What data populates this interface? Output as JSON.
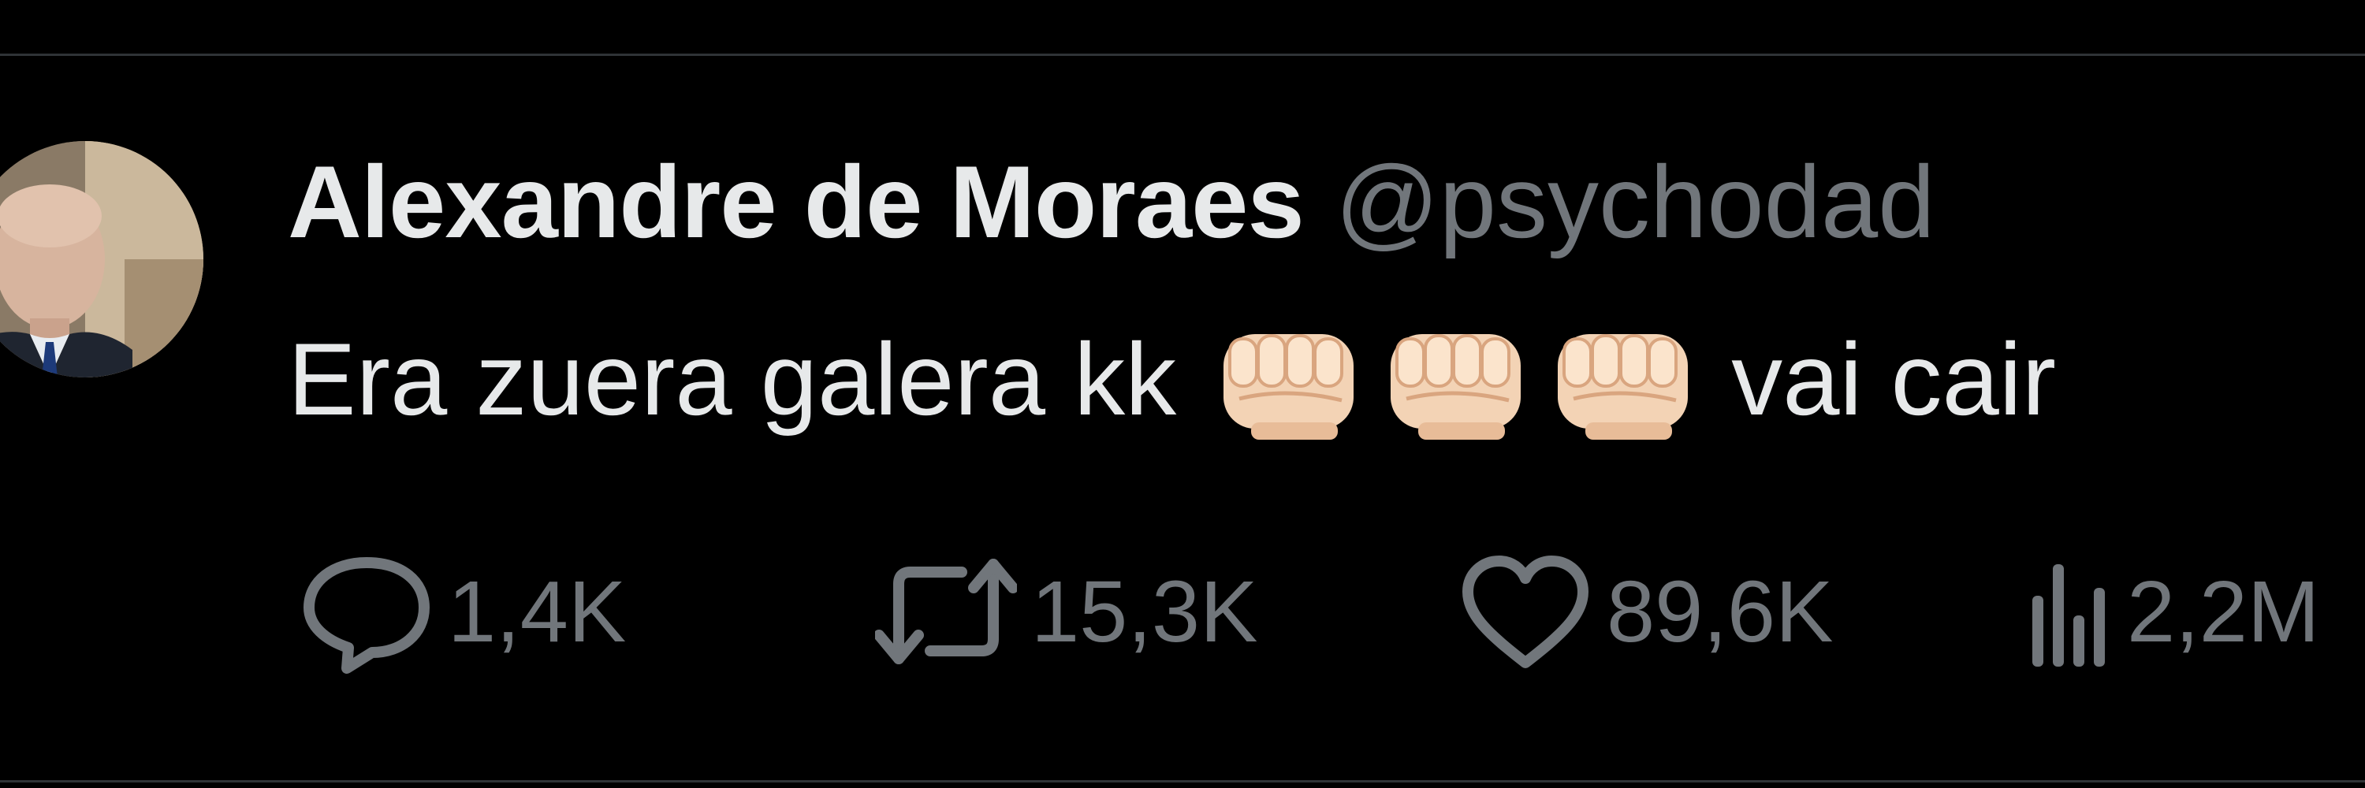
{
  "tweet": {
    "author": {
      "display_name": "Alexandre de Moraes",
      "handle": "@psychodad"
    },
    "text_before_emoji": "Era zuera galera kk",
    "emojis": [
      "oncoming-fist-light-skin-tone",
      "oncoming-fist-light-skin-tone",
      "oncoming-fist-light-skin-tone"
    ],
    "text_after_emoji": "vai cair",
    "metrics": {
      "replies": "1,4K",
      "retweets": "15,3K",
      "likes": "89,6K",
      "views": "2,2M"
    }
  },
  "colors": {
    "background": "#000000",
    "primary_text": "#e7e9ea",
    "secondary_text": "#71767b",
    "divider": "#2f3336"
  }
}
